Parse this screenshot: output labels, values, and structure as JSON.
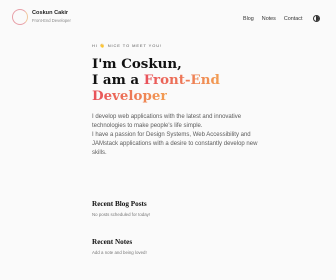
{
  "brand": {
    "name": "Coskun Cakir",
    "role": "Front-End Developer"
  },
  "nav": {
    "items": [
      {
        "label": "Blog"
      },
      {
        "label": "Notes"
      },
      {
        "label": "Contact"
      }
    ],
    "theme_toggle_icon": "half-circle-contrast-icon"
  },
  "hero": {
    "kicker": "HI 👋 NICE TO MEET YOU!",
    "line1": "I'm Coskun,",
    "line2_prefix": "I am a ",
    "line2_accent": "Front-End",
    "line3_accent": "Developer",
    "bio": "I develop web applications with the latest and innovative technologies to make people's life simple.",
    "bio2": "I have a passion for Design Systems, Web Accessibility and JAMstack applications with a desire to constantly develop new skills."
  },
  "blog": {
    "title": "Recent Blog Posts",
    "empty_text": "No posts scheduled for today!"
  },
  "notes": {
    "title": "Recent Notes",
    "empty_text": "Add a note and being loved!"
  },
  "colors": {
    "accent_start": "#e8505b",
    "accent_end": "#f29d52",
    "background": "#fafafa"
  }
}
